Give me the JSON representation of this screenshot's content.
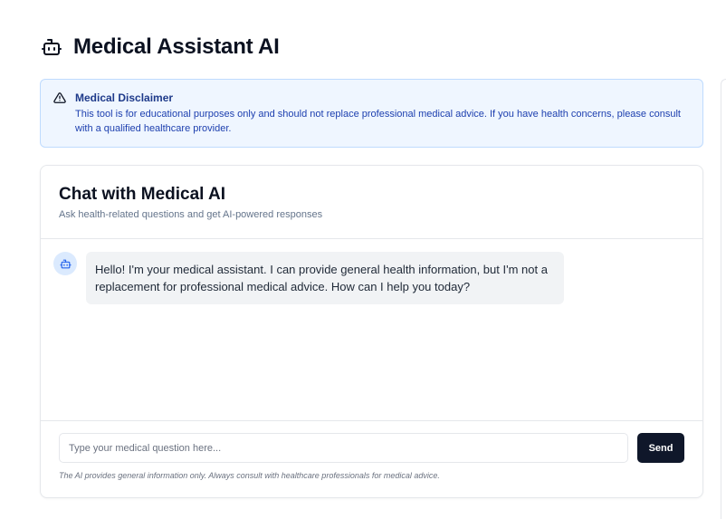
{
  "header": {
    "title": "Medical Assistant AI",
    "icon": "bot-icon"
  },
  "disclaimer": {
    "icon": "alert-triangle-icon",
    "title": "Medical Disclaimer",
    "text": "This tool is for educational purposes only and should not replace professional medical advice. If you have health concerns, please consult with a qualified healthcare provider."
  },
  "chat": {
    "title": "Chat with Medical AI",
    "subtitle": "Ask health-related questions and get AI-powered responses",
    "messages": [
      {
        "role": "assistant",
        "icon": "bot-icon",
        "text": "Hello! I'm your medical assistant. I can provide general health information, but I'm not a replacement for professional medical advice. How can I help you today?"
      }
    ],
    "input": {
      "placeholder": "Type your medical question here...",
      "value": ""
    },
    "send_label": "Send",
    "footnote": "The AI provides general information only. Always consult with healthcare professionals for medical advice."
  },
  "colors": {
    "accent_dark": "#0f172a",
    "disclaimer_bg": "#eff6ff",
    "disclaimer_border": "#bfdbfe",
    "disclaimer_title": "#1e3a8a",
    "avatar_bg": "#dbeafe",
    "bubble_bg": "#f1f3f5"
  }
}
